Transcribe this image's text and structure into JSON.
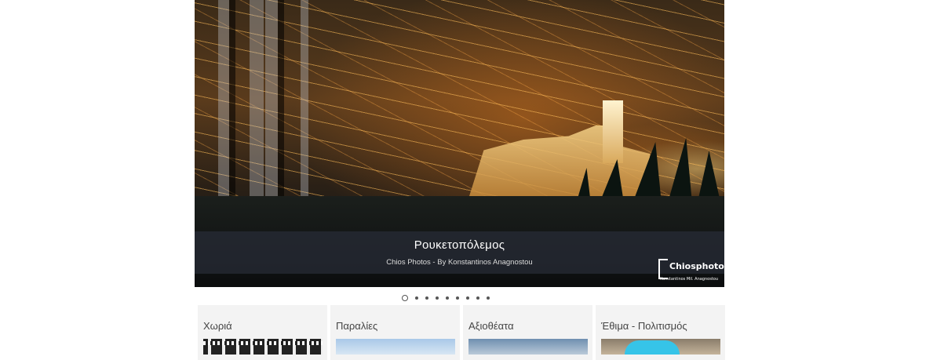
{
  "slider": {
    "caption_title": "Ρουκετοπόλεμος",
    "caption_subtitle": "Chios Photos - By Konstantinos Anagnostou",
    "watermark_logo": "Chiosphotos",
    "watermark_credit": "Konstantinos Mil. Anagnostou",
    "slide_count": 9,
    "active_slide": 1
  },
  "cards": [
    {
      "title": "Χωριά",
      "icon": "village-thumbnail"
    },
    {
      "title": "Παραλίες",
      "icon": "beach-thumbnail"
    },
    {
      "title": "Αξιοθέατα",
      "icon": "sights-thumbnail"
    },
    {
      "title": "Έθιμα - Πολιτισμός",
      "icon": "customs-thumbnail"
    }
  ]
}
